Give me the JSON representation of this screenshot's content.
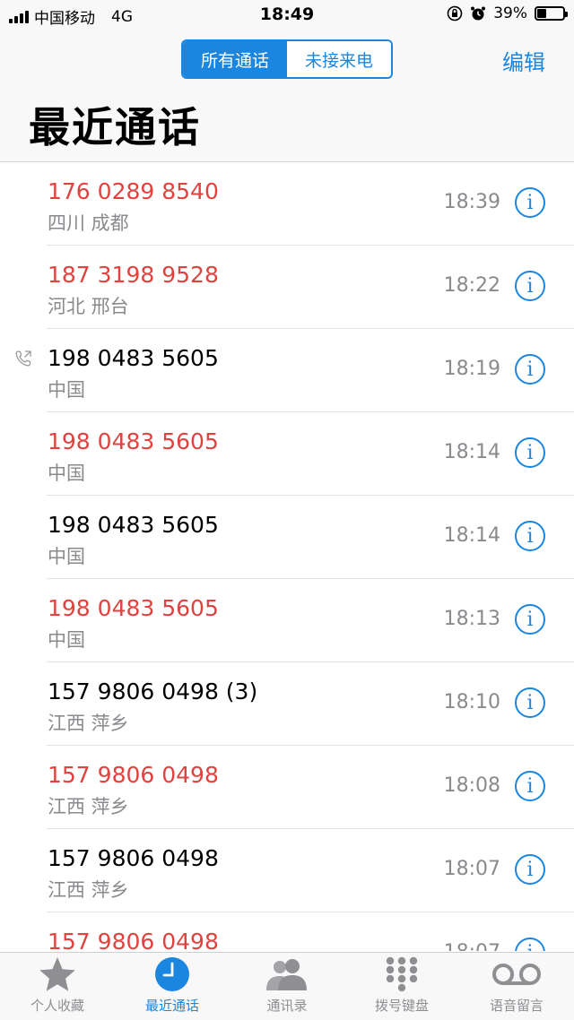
{
  "status_bar": {
    "carrier": "中国移动",
    "network": "4G",
    "time": "18:49",
    "battery_text": "39%",
    "battery_level": 0.39
  },
  "segmented": {
    "all_calls": "所有通话",
    "missed_calls": "未接来电"
  },
  "nav": {
    "edit_label": "编辑",
    "title": "最近通话"
  },
  "calls": [
    {
      "number": "176 0289 8540",
      "location": "四川 成都",
      "time": "18:39",
      "missed": true,
      "outgoing": false
    },
    {
      "number": "187 3198 9528",
      "location": "河北 邢台",
      "time": "18:22",
      "missed": true,
      "outgoing": false
    },
    {
      "number": "198 0483 5605",
      "location": "中国",
      "time": "18:19",
      "missed": false,
      "outgoing": true
    },
    {
      "number": "198 0483 5605",
      "location": "中国",
      "time": "18:14",
      "missed": true,
      "outgoing": false
    },
    {
      "number": "198 0483 5605",
      "location": "中国",
      "time": "18:14",
      "missed": false,
      "outgoing": false
    },
    {
      "number": "198 0483 5605",
      "location": "中国",
      "time": "18:13",
      "missed": true,
      "outgoing": false
    },
    {
      "number": "157 9806 0498 (3)",
      "location": "江西 萍乡",
      "time": "18:10",
      "missed": false,
      "outgoing": false
    },
    {
      "number": "157 9806 0498",
      "location": "江西 萍乡",
      "time": "18:08",
      "missed": true,
      "outgoing": false
    },
    {
      "number": "157 9806 0498",
      "location": "江西 萍乡",
      "time": "18:07",
      "missed": false,
      "outgoing": false
    },
    {
      "number": "157 9806 0498",
      "location": "",
      "time": "18:07",
      "missed": true,
      "outgoing": false
    }
  ],
  "tabs": [
    {
      "label": "个人收藏",
      "icon": "star-icon",
      "active": false
    },
    {
      "label": "最近通话",
      "icon": "clock-icon",
      "active": true
    },
    {
      "label": "通讯录",
      "icon": "contacts-icon",
      "active": false
    },
    {
      "label": "拨号键盘",
      "icon": "keypad-icon",
      "active": false
    },
    {
      "label": "语音留言",
      "icon": "voicemail-icon",
      "active": false
    }
  ],
  "colors": {
    "accent": "#1a86e0",
    "missed": "#e0433f",
    "secondary_text": "#8a8a8e"
  }
}
